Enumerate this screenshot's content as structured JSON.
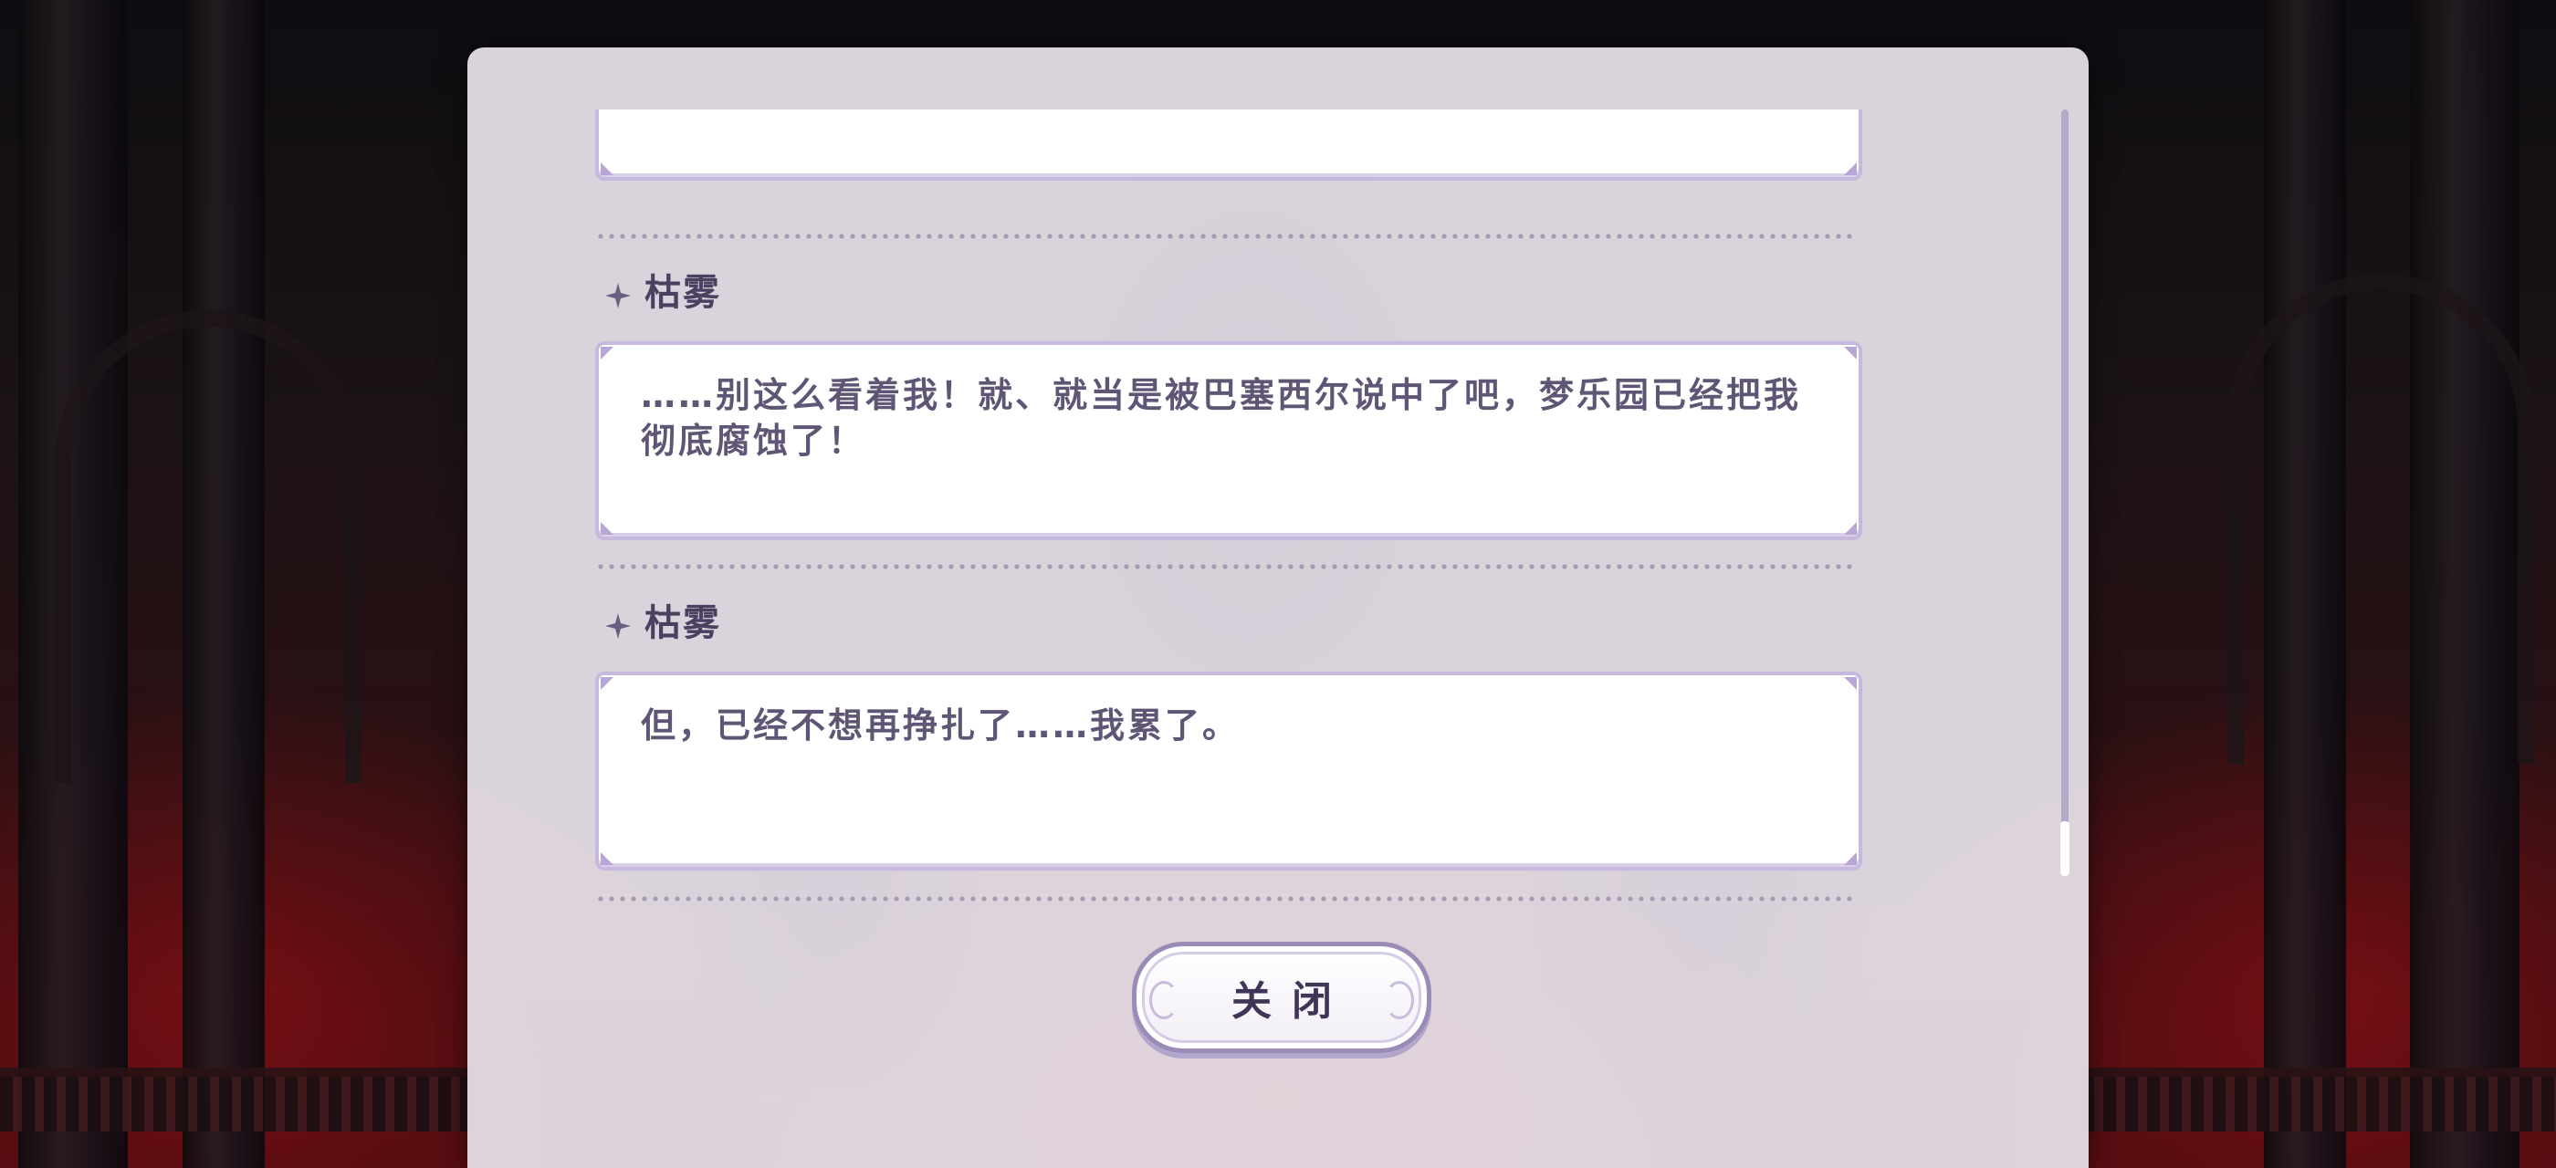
{
  "dialogue_log": {
    "entries": [
      {
        "speaker": "",
        "text": ""
      },
      {
        "speaker": "枯雾",
        "text": "……别这么看着我！就、就当是被巴塞西尔说中了吧，梦乐园已经把我彻底腐蚀了！"
      },
      {
        "speaker": "枯雾",
        "text": "但，已经不想再挣扎了……我累了。"
      }
    ],
    "scroll_position": 1.0
  },
  "footer": {
    "close_label": "关闭"
  },
  "icons": {
    "speaker_marker": "four-point-star-icon"
  },
  "colors": {
    "panel_bg": "#e8e2eb",
    "bubble_border": "#c7b9dd",
    "text": "#5f5676",
    "speaker_name": "#4a4160"
  }
}
